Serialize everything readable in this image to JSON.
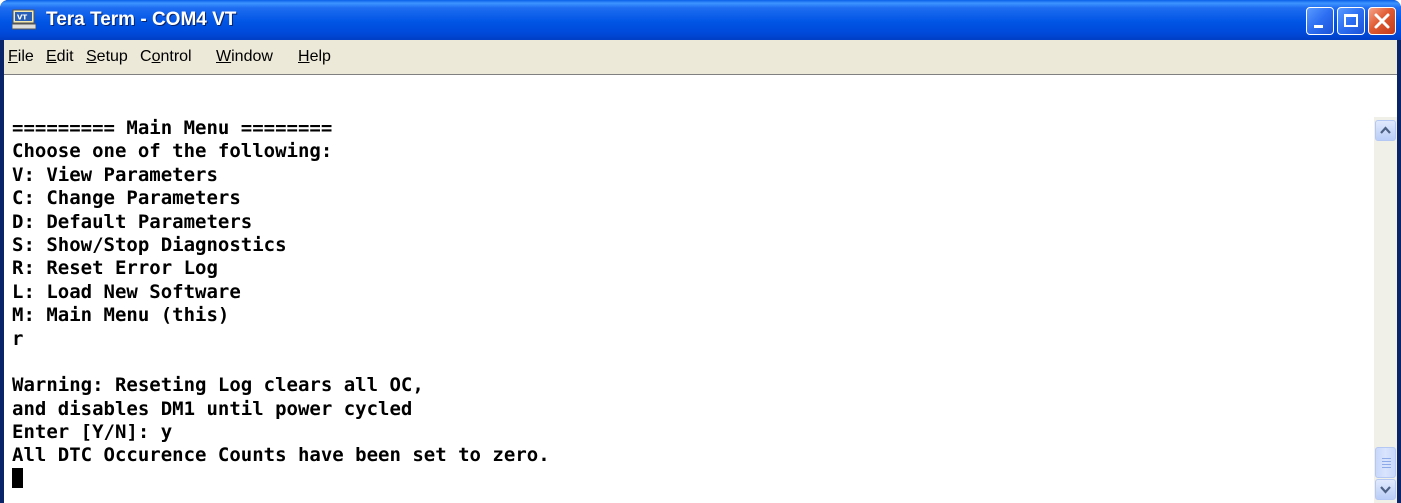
{
  "window": {
    "title": "Tera Term - COM4 VT",
    "icon": "vt-terminal-icon",
    "accent": "#0055e5",
    "close_color": "#e05b32"
  },
  "menu": [
    "File",
    "Edit",
    "Setup",
    "Control",
    "Window",
    "Help"
  ],
  "menu_mnemonics": [
    "F",
    "E",
    "S",
    "o",
    "W",
    "H"
  ],
  "terminal": {
    "lines": [
      "========= Main Menu ========",
      "Choose one of the following:",
      "V: View Parameters",
      "C: Change Parameters",
      "D: Default Parameters",
      "S: Show/Stop Diagnostics",
      "R: Reset Error Log",
      "L: Load New Software",
      "M: Main Menu (this)",
      "r",
      "",
      "Warning: Reseting Log clears all OC,",
      "and disables DM1 until power cycled",
      "Enter [Y/N]: y",
      "All DTC Occurence Counts have been set to zero."
    ],
    "background": "#ffffff",
    "foreground": "#000000"
  },
  "scrollbar": {
    "up_icon": "scroll-up-arrow-icon",
    "down_icon": "scroll-down-arrow-icon",
    "position": "bottom"
  }
}
